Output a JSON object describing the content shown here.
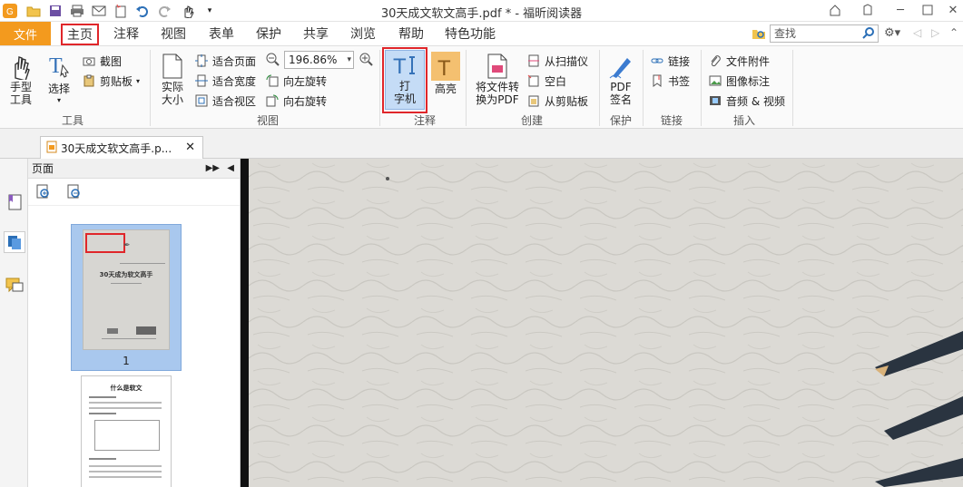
{
  "window": {
    "title": "30天成文软文高手.pdf * - 福昕阅读器"
  },
  "menu": {
    "file": "文件",
    "tabs": [
      "主页",
      "注释",
      "视图",
      "表单",
      "保护",
      "共享",
      "浏览",
      "帮助",
      "特色功能"
    ],
    "active_tab": "主页",
    "search_placeholder": "查找"
  },
  "ribbon": {
    "tools": {
      "hand": "手型\n工具",
      "select": "选择",
      "screenshot": "截图",
      "clipboard": "剪贴板",
      "group": "工具"
    },
    "view": {
      "actual_size": "实际\n大小",
      "fit_page": "适合页面",
      "fit_width": "适合宽度",
      "fit_visible": "适合视区",
      "zoom": "196.86%",
      "rotate_left": "向左旋转",
      "rotate_right": "向右旋转",
      "group": "视图"
    },
    "annotate": {
      "typewriter": "打\n字机",
      "highlight": "高亮",
      "group": "注释"
    },
    "create": {
      "to_pdf": "将文件转\n换为PDF",
      "from_scanner": "从扫描仪",
      "blank": "空白",
      "from_clipboard": "从剪贴板",
      "group": "创建"
    },
    "protect": {
      "pdf_sign": "PDF\n签名",
      "group": "保护"
    },
    "links": {
      "link": "链接",
      "bookmark": "书签",
      "group": "链接"
    },
    "insert": {
      "file_attach": "文件附件",
      "image_annot": "图像标注",
      "audio_video": "音频 & 视频",
      "group": "插入"
    }
  },
  "doc_tab": {
    "name": "30天成文软文高手.p..."
  },
  "panel": {
    "title": "页面",
    "page1_number": "1",
    "thumb1_title": "30天成为软文高手",
    "thumb2_title": "什么是软文"
  },
  "colors": {
    "file_tab": "#f39a1e",
    "highlight_border": "#e0262a",
    "selected_thumb": "#a9c8ee",
    "doc_bg": "#dcdad5"
  }
}
